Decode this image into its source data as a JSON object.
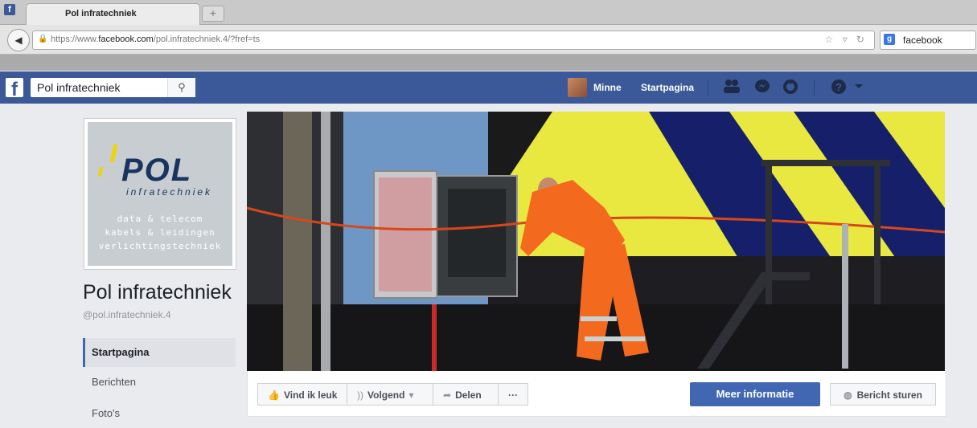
{
  "browser": {
    "tab_title": "Pol infratechniek",
    "new_tab": "+",
    "url_prefix": "https://www.",
    "url_domain": "facebook.com",
    "url_path": "/pol.infratechniek.4/?fref=ts",
    "search_engine": "facebook"
  },
  "fb_header": {
    "search_value": "Pol infratechniek",
    "user_name": "Minne",
    "home_label": "Startpagina",
    "icons": [
      "friends-icon",
      "messages-icon",
      "notifications-icon",
      "help-icon",
      "account-menu-icon"
    ]
  },
  "page": {
    "logo": {
      "brand": "POL",
      "sub": "infratechniek",
      "lines": [
        "data & telecom",
        "kabels & leidingen",
        "verlichtingstechniek"
      ]
    },
    "name": "Pol infratechniek",
    "handle": "@pol.infratechniek.4",
    "nav": [
      "Startpagina",
      "Berichten",
      "Foto's"
    ]
  },
  "actions": {
    "like": "Vind ik leuk",
    "follow": "Volgend",
    "share": "Delen",
    "more": "···",
    "primary": "Meer informatie",
    "message": "Bericht sturen"
  },
  "colors": {
    "fb_blue": "#3b5998",
    "button_blue": "#4267b2",
    "accent_yellow": "#f0d400",
    "logo_navy": "#17355e"
  }
}
